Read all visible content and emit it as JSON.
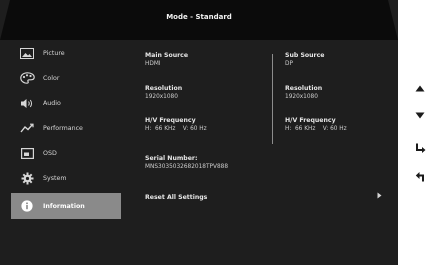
{
  "header": {
    "title": "Mode - Standard"
  },
  "sidebar": {
    "items": [
      {
        "label": "Picture",
        "icon": "picture-icon"
      },
      {
        "label": "Color",
        "icon": "palette-icon"
      },
      {
        "label": "Audio",
        "icon": "speaker-icon"
      },
      {
        "label": "Performance",
        "icon": "performance-icon"
      },
      {
        "label": "OSD",
        "icon": "osd-icon"
      },
      {
        "label": "System",
        "icon": "gear-icon"
      },
      {
        "label": "Information",
        "icon": "info-icon",
        "active": true
      }
    ]
  },
  "info": {
    "main_source": {
      "title": "Main Source",
      "value": "HDMI"
    },
    "sub_source": {
      "title": "Sub Source",
      "value": "DP"
    },
    "main_resolution": {
      "title": "Resolution",
      "value": "1920x1080"
    },
    "sub_resolution": {
      "title": "Resolution",
      "value": "1920x1080"
    },
    "main_frequency": {
      "title": "H/V Frequency",
      "value": "H:  66 KHz    V: 60 Hz"
    },
    "sub_frequency": {
      "title": "H/V Frequency",
      "value": "H:  66 KHz    V: 60 Hz"
    },
    "serial": {
      "title": "Serial Number:",
      "value": "MNS3035032682018TPV888"
    },
    "reset_label": "Reset All Settings"
  },
  "nav_keys": [
    "up-arrow-icon",
    "down-arrow-icon",
    "enter-icon",
    "back-icon"
  ],
  "colors": {
    "panel": "#1e1e1e",
    "header": "#0b0b0b",
    "active": "#8a8a8a",
    "text": "#e6e6e6"
  }
}
